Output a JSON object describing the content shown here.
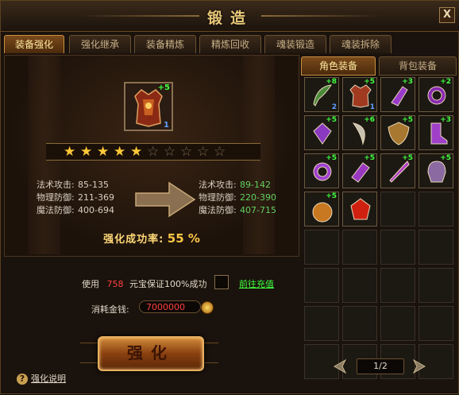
{
  "window": {
    "title": "锻造",
    "close_label": "X"
  },
  "tabs": [
    {
      "label": "装备强化",
      "active": true
    },
    {
      "label": "强化继承",
      "active": false
    },
    {
      "label": "装备精炼",
      "active": false
    },
    {
      "label": "精炼回收",
      "active": false
    },
    {
      "label": "魂装锻造",
      "active": false
    },
    {
      "label": "魂装拆除",
      "active": false
    }
  ],
  "item": {
    "plus": "+5",
    "count": "1",
    "icon": "armor-icon"
  },
  "stars": {
    "filled": 5,
    "total": 10
  },
  "stats_before": [
    {
      "label": "法术攻击:",
      "value": "85-135"
    },
    {
      "label": "物理防御:",
      "value": "211-369"
    },
    {
      "label": "魔法防御:",
      "value": "400-694"
    }
  ],
  "stats_after": [
    {
      "label": "法术攻击:",
      "value": "89-142"
    },
    {
      "label": "物理防御:",
      "value": "220-390"
    },
    {
      "label": "魔法防御:",
      "value": "407-715"
    }
  ],
  "success_rate": {
    "label": "强化成功率:",
    "value": "55 %"
  },
  "options": {
    "use_prefix": "使用",
    "use_amount": "758",
    "use_suffix": "元宝保证100%成功",
    "recharge_link": "前往充值",
    "cost_label": "消耗金钱:",
    "cost_value": "7000000"
  },
  "forge_button": "强化",
  "help_link": "强化说明",
  "right_tabs": [
    {
      "label": "角色装备",
      "active": true
    },
    {
      "label": "背包装备",
      "active": false
    }
  ],
  "inventory": [
    {
      "plus": "+8",
      "count": "2",
      "icon": "blade-icon",
      "color": "#4a8a3a"
    },
    {
      "plus": "+5",
      "count": "1",
      "icon": "armor-icon",
      "color": "#a03a20"
    },
    {
      "plus": "+3",
      "count": "",
      "icon": "gauntlet-icon",
      "color": "#9a3ac8"
    },
    {
      "plus": "+2",
      "count": "",
      "icon": "ring-icon",
      "color": "#8a2ab0"
    },
    {
      "plus": "+5",
      "count": "",
      "icon": "amulet-icon",
      "color": "#8a3ac0"
    },
    {
      "plus": "+6",
      "count": "",
      "icon": "fang-icon",
      "color": "#c8c0b0"
    },
    {
      "plus": "+5",
      "count": "",
      "icon": "shield-icon",
      "color": "#a87830"
    },
    {
      "plus": "+3",
      "count": "",
      "icon": "boots-icon",
      "color": "#a040c8"
    },
    {
      "plus": "+5",
      "count": "",
      "icon": "ring-icon",
      "color": "#a040d0"
    },
    {
      "plus": "+5",
      "count": "",
      "icon": "bracer-icon",
      "color": "#9a38c0"
    },
    {
      "plus": "+5",
      "count": "",
      "icon": "wand-icon",
      "color": "#b040c0"
    },
    {
      "plus": "+5",
      "count": "",
      "icon": "helmet-icon",
      "color": "#8a6aa0"
    },
    {
      "plus": "+5",
      "count": "",
      "icon": "medal-icon",
      "color": "#c87820"
    },
    {
      "plus": "",
      "count": "",
      "icon": "gem-icon",
      "color": "#d02010"
    }
  ],
  "pager": {
    "text": "1/2"
  }
}
